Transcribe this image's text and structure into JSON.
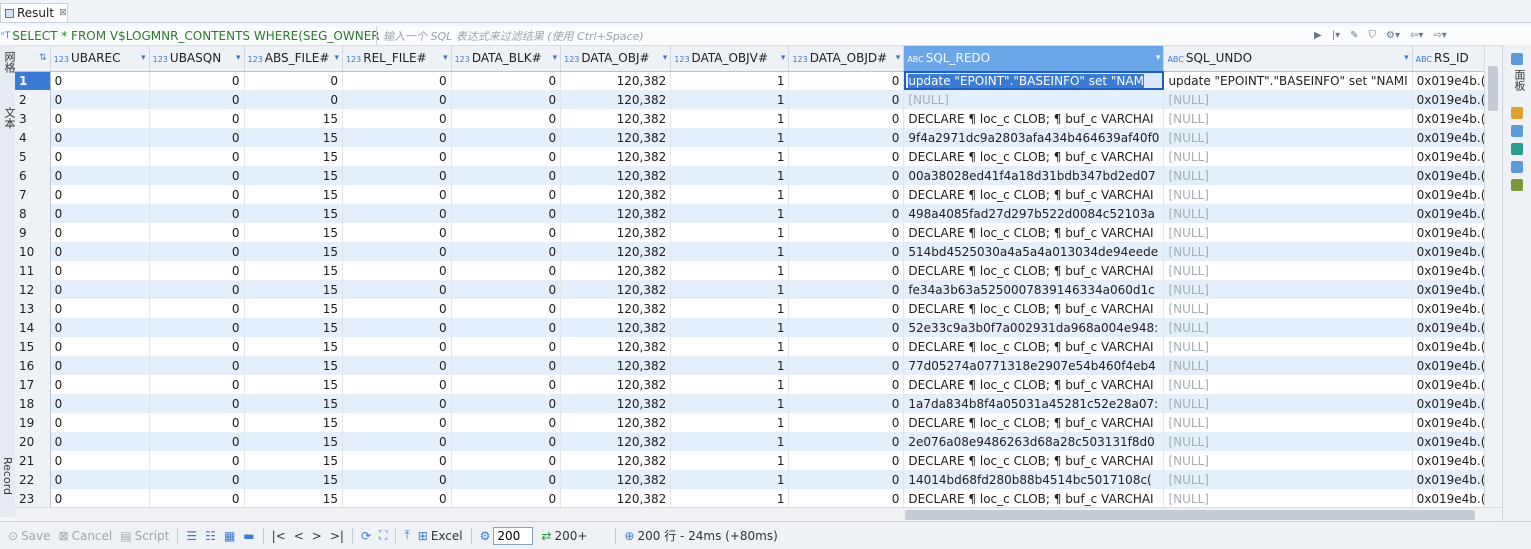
{
  "tab": {
    "label": "Result",
    "close": "⊠"
  },
  "filter": {
    "sql": "SELECT * FROM V$LOGMNR_CONTENTS WHERE(SEG_OWNER",
    "placeholder": "输入一个 SQL 表达式来过滤结果 (使用 Ctrl+Space)"
  },
  "left_tabs": {
    "grid": "网格",
    "text": "文本",
    "record": "Record"
  },
  "right_tabs": {
    "panels": "面板"
  },
  "columns": [
    {
      "label": "UBAREC",
      "type": "123"
    },
    {
      "label": "UBASQN",
      "type": "123"
    },
    {
      "label": "ABS_FILE#",
      "type": "123"
    },
    {
      "label": "REL_FILE#",
      "type": "123"
    },
    {
      "label": "DATA_BLK#",
      "type": "123"
    },
    {
      "label": "DATA_OBJ#",
      "type": "123"
    },
    {
      "label": "DATA_OBJV#",
      "type": "123"
    },
    {
      "label": "DATA_OBJD#",
      "type": "123"
    },
    {
      "label": "SQL_REDO",
      "type": "ABC"
    },
    {
      "label": "SQL_UNDO",
      "type": "ABC"
    },
    {
      "label": "RS_ID",
      "type": "ABC"
    }
  ],
  "rows": [
    {
      "n": "1",
      "ubarec": "0",
      "ubasqn": "0",
      "abs": "0",
      "rel": "0",
      "blk": "0",
      "obj": "120,382",
      "objv": "1",
      "objd": "0",
      "redo": "update \"EPOINT\".\"BASEINFO\" set \"NAM",
      "undo": "update \"EPOINT\".\"BASEINFO\" set \"NAMI",
      "rs": "0x019e4b.("
    },
    {
      "n": "2",
      "ubarec": "0",
      "ubasqn": "0",
      "abs": "0",
      "rel": "0",
      "blk": "0",
      "obj": "120,382",
      "objv": "1",
      "objd": "0",
      "redo": "[NULL]",
      "undo": "[NULL]",
      "rs": "0x019e4b.("
    },
    {
      "n": "3",
      "ubarec": "0",
      "ubasqn": "0",
      "abs": "15",
      "rel": "0",
      "blk": "0",
      "obj": "120,382",
      "objv": "1",
      "objd": "0",
      "redo": "DECLARE ¶ loc_c CLOB; ¶ buf_c VARCHAI",
      "undo": "[NULL]",
      "rs": "0x019e4b.("
    },
    {
      "n": "4",
      "ubarec": "0",
      "ubasqn": "0",
      "abs": "15",
      "rel": "0",
      "blk": "0",
      "obj": "120,382",
      "objv": "1",
      "objd": "0",
      "redo": "9f4a2971dc9a2803afa434b464639af40f0",
      "undo": "[NULL]",
      "rs": "0x019e4b.("
    },
    {
      "n": "5",
      "ubarec": "0",
      "ubasqn": "0",
      "abs": "15",
      "rel": "0",
      "blk": "0",
      "obj": "120,382",
      "objv": "1",
      "objd": "0",
      "redo": "DECLARE ¶ loc_c CLOB; ¶ buf_c VARCHAI",
      "undo": "[NULL]",
      "rs": "0x019e4b.("
    },
    {
      "n": "6",
      "ubarec": "0",
      "ubasqn": "0",
      "abs": "15",
      "rel": "0",
      "blk": "0",
      "obj": "120,382",
      "objv": "1",
      "objd": "0",
      "redo": "00a38028ed41f4a18d31bdb347bd2ed07",
      "undo": "[NULL]",
      "rs": "0x019e4b.("
    },
    {
      "n": "7",
      "ubarec": "0",
      "ubasqn": "0",
      "abs": "15",
      "rel": "0",
      "blk": "0",
      "obj": "120,382",
      "objv": "1",
      "objd": "0",
      "redo": "DECLARE ¶ loc_c CLOB; ¶ buf_c VARCHAI",
      "undo": "[NULL]",
      "rs": "0x019e4b.("
    },
    {
      "n": "8",
      "ubarec": "0",
      "ubasqn": "0",
      "abs": "15",
      "rel": "0",
      "blk": "0",
      "obj": "120,382",
      "objv": "1",
      "objd": "0",
      "redo": "498a4085fad27d297b522d0084c52103a",
      "undo": "[NULL]",
      "rs": "0x019e4b.("
    },
    {
      "n": "9",
      "ubarec": "0",
      "ubasqn": "0",
      "abs": "15",
      "rel": "0",
      "blk": "0",
      "obj": "120,382",
      "objv": "1",
      "objd": "0",
      "redo": "DECLARE ¶ loc_c CLOB; ¶ buf_c VARCHAI",
      "undo": "[NULL]",
      "rs": "0x019e4b.("
    },
    {
      "n": "10",
      "ubarec": "0",
      "ubasqn": "0",
      "abs": "15",
      "rel": "0",
      "blk": "0",
      "obj": "120,382",
      "objv": "1",
      "objd": "0",
      "redo": "514bd4525030a4a5a4a013034de94eede",
      "undo": "[NULL]",
      "rs": "0x019e4b.("
    },
    {
      "n": "11",
      "ubarec": "0",
      "ubasqn": "0",
      "abs": "15",
      "rel": "0",
      "blk": "0",
      "obj": "120,382",
      "objv": "1",
      "objd": "0",
      "redo": "DECLARE ¶ loc_c CLOB; ¶ buf_c VARCHAI",
      "undo": "[NULL]",
      "rs": "0x019e4b.("
    },
    {
      "n": "12",
      "ubarec": "0",
      "ubasqn": "0",
      "abs": "15",
      "rel": "0",
      "blk": "0",
      "obj": "120,382",
      "objv": "1",
      "objd": "0",
      "redo": "fe34a3b63a5250007839146334a060d1c",
      "undo": "[NULL]",
      "rs": "0x019e4b.("
    },
    {
      "n": "13",
      "ubarec": "0",
      "ubasqn": "0",
      "abs": "15",
      "rel": "0",
      "blk": "0",
      "obj": "120,382",
      "objv": "1",
      "objd": "0",
      "redo": "DECLARE ¶ loc_c CLOB; ¶ buf_c VARCHAI",
      "undo": "[NULL]",
      "rs": "0x019e4b.("
    },
    {
      "n": "14",
      "ubarec": "0",
      "ubasqn": "0",
      "abs": "15",
      "rel": "0",
      "blk": "0",
      "obj": "120,382",
      "objv": "1",
      "objd": "0",
      "redo": "52e33c9a3b0f7a002931da968a004e948:",
      "undo": "[NULL]",
      "rs": "0x019e4b.("
    },
    {
      "n": "15",
      "ubarec": "0",
      "ubasqn": "0",
      "abs": "15",
      "rel": "0",
      "blk": "0",
      "obj": "120,382",
      "objv": "1",
      "objd": "0",
      "redo": "DECLARE ¶ loc_c CLOB; ¶ buf_c VARCHAI",
      "undo": "[NULL]",
      "rs": "0x019e4b.("
    },
    {
      "n": "16",
      "ubarec": "0",
      "ubasqn": "0",
      "abs": "15",
      "rel": "0",
      "blk": "0",
      "obj": "120,382",
      "objv": "1",
      "objd": "0",
      "redo": "77d05274a0771318e2907e54b460f4eb4",
      "undo": "[NULL]",
      "rs": "0x019e4b.("
    },
    {
      "n": "17",
      "ubarec": "0",
      "ubasqn": "0",
      "abs": "15",
      "rel": "0",
      "blk": "0",
      "obj": "120,382",
      "objv": "1",
      "objd": "0",
      "redo": "DECLARE ¶ loc_c CLOB; ¶ buf_c VARCHAI",
      "undo": "[NULL]",
      "rs": "0x019e4b.("
    },
    {
      "n": "18",
      "ubarec": "0",
      "ubasqn": "0",
      "abs": "15",
      "rel": "0",
      "blk": "0",
      "obj": "120,382",
      "objv": "1",
      "objd": "0",
      "redo": "1a7da834b8f4a05031a45281c52e28a07:",
      "undo": "[NULL]",
      "rs": "0x019e4b.("
    },
    {
      "n": "19",
      "ubarec": "0",
      "ubasqn": "0",
      "abs": "15",
      "rel": "0",
      "blk": "0",
      "obj": "120,382",
      "objv": "1",
      "objd": "0",
      "redo": "DECLARE ¶ loc_c CLOB; ¶ buf_c VARCHAI",
      "undo": "[NULL]",
      "rs": "0x019e4b.("
    },
    {
      "n": "20",
      "ubarec": "0",
      "ubasqn": "0",
      "abs": "15",
      "rel": "0",
      "blk": "0",
      "obj": "120,382",
      "objv": "1",
      "objd": "0",
      "redo": "2e076a08e9486263d68a28c503131f8d0",
      "undo": "[NULL]",
      "rs": "0x019e4b.("
    },
    {
      "n": "21",
      "ubarec": "0",
      "ubasqn": "0",
      "abs": "15",
      "rel": "0",
      "blk": "0",
      "obj": "120,382",
      "objv": "1",
      "objd": "0",
      "redo": "DECLARE ¶ loc_c CLOB; ¶ buf_c VARCHAI",
      "undo": "[NULL]",
      "rs": "0x019e4b.("
    },
    {
      "n": "22",
      "ubarec": "0",
      "ubasqn": "0",
      "abs": "15",
      "rel": "0",
      "blk": "0",
      "obj": "120,382",
      "objv": "1",
      "objd": "0",
      "redo": "14014bd68fd280b88b4514bc5017108c(",
      "undo": "[NULL]",
      "rs": "0x019e4b.("
    },
    {
      "n": "23",
      "ubarec": "0",
      "ubasqn": "0",
      "abs": "15",
      "rel": "0",
      "blk": "0",
      "obj": "120,382",
      "objv": "1",
      "objd": "0",
      "redo": "DECLARE ¶ loc_c CLOB; ¶ buf_c VARCHAI",
      "undo": "[NULL]",
      "rs": "0x019e4b.("
    }
  ],
  "bottom": {
    "save": "Save",
    "cancel": "Cancel",
    "script": "Script",
    "excel": "Excel",
    "fetch_size": "200",
    "fetch_more": "200+",
    "status": "200 行 - 24ms (+80ms)"
  },
  "colors": {
    "accent": "#3a7bd5",
    "row_alt": "#e5eefb",
    "sql_green": "#2a7a2a"
  },
  "icons": [
    "close-icon",
    "filter-icon",
    "sort-icon",
    "save-icon",
    "cancel-icon",
    "script-icon",
    "excel-icon",
    "refresh-icon",
    "gear-icon",
    "first-page-icon",
    "prev-page-icon",
    "next-page-icon",
    "last-page-icon"
  ]
}
